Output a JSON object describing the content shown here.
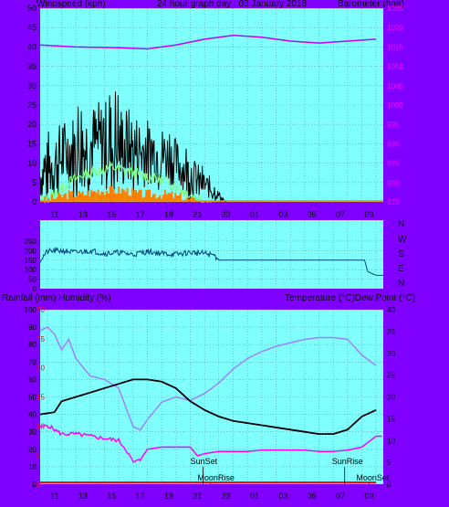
{
  "top_header": {
    "left": "Windspeed (kph)",
    "center": "24 hour graph day : 03 January 2018",
    "right": "Barometer (hpa)"
  },
  "bottom_header": {
    "left": "Rainfall (mm)  Humidity (%)",
    "right": "Temperature (°C)Dew Point (°C)"
  },
  "x_ticks": [
    "11",
    "13",
    "15",
    "17",
    "19",
    "21",
    "23",
    "01",
    "03",
    "05",
    "07",
    "09"
  ],
  "direction_labels": [
    "N",
    "W",
    "S",
    "E",
    "N"
  ],
  "event_labels": {
    "sunset": "SunSet",
    "sunrise": "SunRise",
    "moonrise": "MoonRise",
    "moonset": "MoonSet"
  },
  "colors": {
    "frame": "#8000ff",
    "plot_bg": "#80ffff",
    "wind": "#000000",
    "gust_green": "#80ff80",
    "wind_orange": "#ff8000",
    "barometer": "#c000ff",
    "direction": "#004080",
    "temperature": "#000000",
    "dew_point": "#ff00ff",
    "humidity": "#a080ff",
    "rain": "#ff0000"
  },
  "chart_data": [
    {
      "type": "line",
      "title": "24 hour graph day : 03 January 2018",
      "xlabel": "",
      "ylabel": "Windspeed (kph)",
      "y2label": "Barometer (hpa)",
      "ylim": [
        0,
        50
      ],
      "y_ticks": [
        0,
        5,
        10,
        15,
        20,
        25,
        30,
        35,
        40,
        45,
        50
      ],
      "y2lim": [
        975,
        1025
      ],
      "y2_ticks": [
        975,
        980,
        985,
        990,
        995,
        1000,
        1005,
        1010,
        1015,
        1020,
        1025
      ],
      "x_hours": [
        10,
        11,
        12,
        13,
        14,
        15,
        16,
        17,
        18,
        19,
        20,
        21,
        22,
        23,
        24,
        25,
        26,
        27,
        28,
        29,
        30,
        31,
        32,
        33
      ],
      "series": [
        {
          "name": "Windspeed",
          "axis": "left",
          "kind": "wind",
          "hours": [
            9.5,
            10.5,
            11.5,
            12.5,
            13.5,
            14.5,
            15.5,
            16.5,
            17.5,
            18.5,
            19.5,
            20.5,
            21.5,
            22.5
          ],
          "avg": [
            6,
            9,
            12,
            13,
            14,
            13,
            13,
            12,
            12,
            11,
            8,
            5,
            3,
            0
          ],
          "max": [
            14,
            21,
            24,
            26,
            28,
            29,
            27,
            24,
            22,
            20,
            15,
            11,
            6,
            0
          ]
        },
        {
          "name": "Gust",
          "axis": "left",
          "kind": "gust",
          "hours": [
            9.5,
            10.5,
            11.5,
            12.5,
            13.5,
            14.5,
            15.5,
            16.5,
            17.5,
            18.5,
            19.5,
            20.5,
            21.5
          ],
          "values": [
            0,
            2,
            5,
            7,
            8,
            9,
            8,
            7,
            6,
            5,
            3,
            1,
            0
          ]
        },
        {
          "name": "Average",
          "axis": "left",
          "kind": "orange",
          "hours": [
            9.5,
            10.5,
            11.5,
            12.5,
            13.5,
            14.5,
            15.5,
            16.5,
            17.5,
            18.5,
            19.5,
            20.5
          ],
          "values": [
            0,
            1,
            2,
            2,
            3,
            3,
            3,
            2,
            2,
            2,
            1,
            0
          ]
        },
        {
          "name": "Barometer",
          "axis": "right",
          "kind": "baro",
          "hours": [
            9.5,
            12,
            15,
            17,
            19,
            21,
            23,
            25,
            27,
            29,
            31,
            33
          ],
          "values": [
            1015.5,
            1015,
            1014.8,
            1014.5,
            1015.5,
            1017,
            1018,
            1017.5,
            1016.5,
            1016,
            1016.5,
            1017
          ]
        }
      ]
    },
    {
      "type": "line",
      "ylabel": "Wind direction",
      "ylim": [
        0,
        360
      ],
      "y_ticks": [
        0,
        50,
        100,
        150,
        200,
        250
      ],
      "series": [
        {
          "name": "Direction",
          "hours": [
            9.5,
            10,
            11,
            12,
            13,
            14,
            15,
            16,
            17,
            18,
            19,
            20,
            21,
            21.7,
            22,
            26,
            30,
            32.2,
            32.4,
            33,
            33.5
          ],
          "values": [
            150,
            195,
            200,
            190,
            200,
            185,
            190,
            180,
            195,
            185,
            180,
            190,
            185,
            175,
            150,
            150,
            150,
            150,
            90,
            70,
            70
          ]
        }
      ]
    },
    {
      "type": "line",
      "ylabel": "Rainfall (mm)  Humidity (%)",
      "y2label": "Temperature (°C)Dew Point (°C)",
      "ylim": [
        0,
        100
      ],
      "y_ticks": [
        0,
        10,
        20,
        30,
        40,
        50,
        60,
        70,
        80,
        90,
        100
      ],
      "rain_ticks": [
        0,
        5,
        10,
        15,
        20,
        25,
        30
      ],
      "y2lim": [
        0,
        40
      ],
      "y2_ticks": [
        0,
        5,
        10,
        15,
        20,
        25,
        30,
        35,
        40
      ],
      "series": [
        {
          "name": "Temperature",
          "axis": "right",
          "hours": [
            9.5,
            10.5,
            11,
            12,
            13,
            14,
            15,
            16,
            17,
            18,
            19,
            20,
            21,
            22,
            23,
            24,
            25,
            26,
            27,
            28,
            29,
            30,
            31,
            32,
            33
          ],
          "values": [
            16,
            16.5,
            19,
            20,
            21,
            22,
            23,
            24,
            24,
            23.5,
            22,
            19,
            17,
            15.5,
            14.5,
            14,
            13.5,
            13,
            12.5,
            12,
            11.5,
            11.5,
            12.5,
            15.5,
            17
          ]
        },
        {
          "name": "Humidity",
          "axis": "left",
          "hours": [
            9.5,
            10,
            10.5,
            11,
            11.5,
            12,
            13,
            14,
            15,
            16,
            16.5,
            17,
            18,
            19,
            20,
            21,
            22,
            23,
            24,
            25,
            26,
            27,
            28,
            29,
            30,
            31,
            32,
            33
          ],
          "values": [
            88,
            90,
            86,
            77,
            83,
            72,
            62,
            60,
            55,
            33,
            31,
            37,
            47,
            50,
            48,
            52,
            58,
            66,
            72,
            76,
            79,
            81,
            83,
            84,
            84,
            83,
            74,
            68
          ]
        },
        {
          "name": "Dew Point",
          "axis": "right",
          "hours": [
            9.5,
            10,
            11,
            12,
            13,
            14,
            15,
            15.5,
            16,
            16.5,
            17,
            18,
            19,
            20,
            20.5,
            21,
            22,
            23,
            24,
            25,
            26,
            27,
            28,
            29,
            30,
            31,
            32,
            33
          ],
          "values": [
            13,
            13.5,
            11.5,
            11.5,
            11,
            10.5,
            10,
            8,
            5,
            5.5,
            8,
            8.5,
            8.5,
            8.5,
            6.5,
            7,
            7.5,
            7.5,
            7.5,
            7.8,
            7.8,
            7.8,
            7.8,
            7.5,
            7.5,
            7.8,
            8.5,
            11
          ]
        },
        {
          "name": "Rainfall",
          "axis": "rain",
          "hours": [
            9.5,
            33
          ],
          "values": [
            0.3,
            0.3
          ]
        }
      ]
    }
  ]
}
